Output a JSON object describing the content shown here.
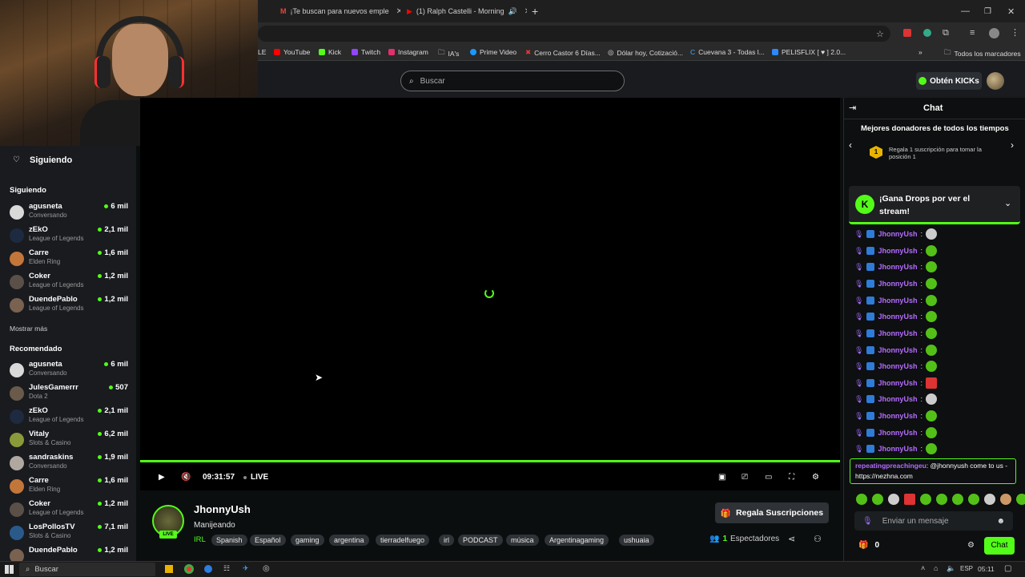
{
  "browser": {
    "tabs": [
      {
        "label": "¡Te buscan para nuevos emple"
      },
      {
        "label": "(1) Ralph Castelli - Morning"
      }
    ],
    "bookmarks": [
      {
        "label": "LE"
      },
      {
        "label": "YouTube"
      },
      {
        "label": "Kick"
      },
      {
        "label": "Twitch"
      },
      {
        "label": "Instagram"
      },
      {
        "label": "IA's"
      },
      {
        "label": "Prime Video"
      },
      {
        "label": "Cerro Castor 6 Días..."
      },
      {
        "label": "Dólar hoy, Cotizació..."
      },
      {
        "label": "Cuevana 3 - Todas l..."
      },
      {
        "label": "PELISFLIX [ ♥ ] 2.0..."
      },
      {
        "label": "Todos los marcadores"
      }
    ]
  },
  "header": {
    "search_placeholder": "Buscar",
    "kicks_button": "Obtén KICKs"
  },
  "sidebar": {
    "following_header": "Siguiendo",
    "following_title": "Siguiendo",
    "following": [
      {
        "name": "agusneta",
        "category": "Conversando",
        "viewers": "6 mil"
      },
      {
        "name": "zEkO",
        "category": "League of Legends",
        "viewers": "2,1 mil"
      },
      {
        "name": "Carre",
        "category": "Elden Ring",
        "viewers": "1,6 mil"
      },
      {
        "name": "Coker",
        "category": "League of Legends",
        "viewers": "1,2 mil"
      },
      {
        "name": "DuendePablo",
        "category": "League of Legends",
        "viewers": "1,2 mil"
      }
    ],
    "show_more": "Mostrar más",
    "recommended_title": "Recomendado",
    "recommended": [
      {
        "name": "agusneta",
        "category": "Conversando",
        "viewers": "6 mil"
      },
      {
        "name": "JulesGamerrr",
        "category": "Dota 2",
        "viewers": "507"
      },
      {
        "name": "zEkO",
        "category": "League of Legends",
        "viewers": "2,1 mil"
      },
      {
        "name": "Vitaly",
        "category": "Slots & Casino",
        "viewers": "6,2 mil"
      },
      {
        "name": "sandraskins",
        "category": "Conversando",
        "viewers": "1,9 mil"
      },
      {
        "name": "Carre",
        "category": "Elden Ring",
        "viewers": "1,6 mil"
      },
      {
        "name": "Coker",
        "category": "League of Legends",
        "viewers": "1,2 mil"
      },
      {
        "name": "LosPollosTV",
        "category": "Slots & Casino",
        "viewers": "7,1 mil"
      },
      {
        "name": "DuendePablo",
        "category": "",
        "viewers": "1,2 mil"
      }
    ]
  },
  "player": {
    "time": "09:31:57",
    "live_label": "LIVE"
  },
  "stream": {
    "channel": "JhonnyUsh",
    "title": "Manijeando",
    "live_badge": "LIVE",
    "category": "IRL",
    "tags": [
      "Spanish",
      "Español",
      "gaming",
      "argentina",
      "tierradelfuego",
      "irl",
      "PODCAST",
      "música",
      "Argentinagaming",
      "ushuaia"
    ],
    "subs_button": "Regala Suscripciones",
    "viewers_count": "1",
    "viewers_label": "Espectadores"
  },
  "chat": {
    "title": "Chat",
    "top_donors_title": "Mejores donadores de todos los tiempos",
    "top_donors_text": "Regala 1 suscripción para tomar la posición 1",
    "top_donors_rank": "1",
    "drops_text": "¡Gana Drops por ver el stream!",
    "messages": [
      {
        "user": "JhonnyUsh"
      },
      {
        "user": "JhonnyUsh"
      },
      {
        "user": "JhonnyUsh"
      },
      {
        "user": "JhonnyUsh"
      },
      {
        "user": "JhonnyUsh"
      },
      {
        "user": "JhonnyUsh"
      },
      {
        "user": "JhonnyUsh"
      },
      {
        "user": "JhonnyUsh"
      },
      {
        "user": "JhonnyUsh"
      },
      {
        "user": "JhonnyUsh"
      },
      {
        "user": "JhonnyUsh"
      },
      {
        "user": "JhonnyUsh"
      },
      {
        "user": "JhonnyUsh"
      },
      {
        "user": "JhonnyUsh"
      }
    ],
    "highlight_user": "repeatingpreachingeu",
    "highlight_text": "@jhonnyush come to us - https://nezhna.com",
    "input_placeholder": "Enviar un mensaje",
    "kicks_count": "0",
    "send_button": "Chat"
  },
  "taskbar": {
    "search_placeholder": "Buscar",
    "lang": "ESP",
    "clock": "05:11"
  }
}
